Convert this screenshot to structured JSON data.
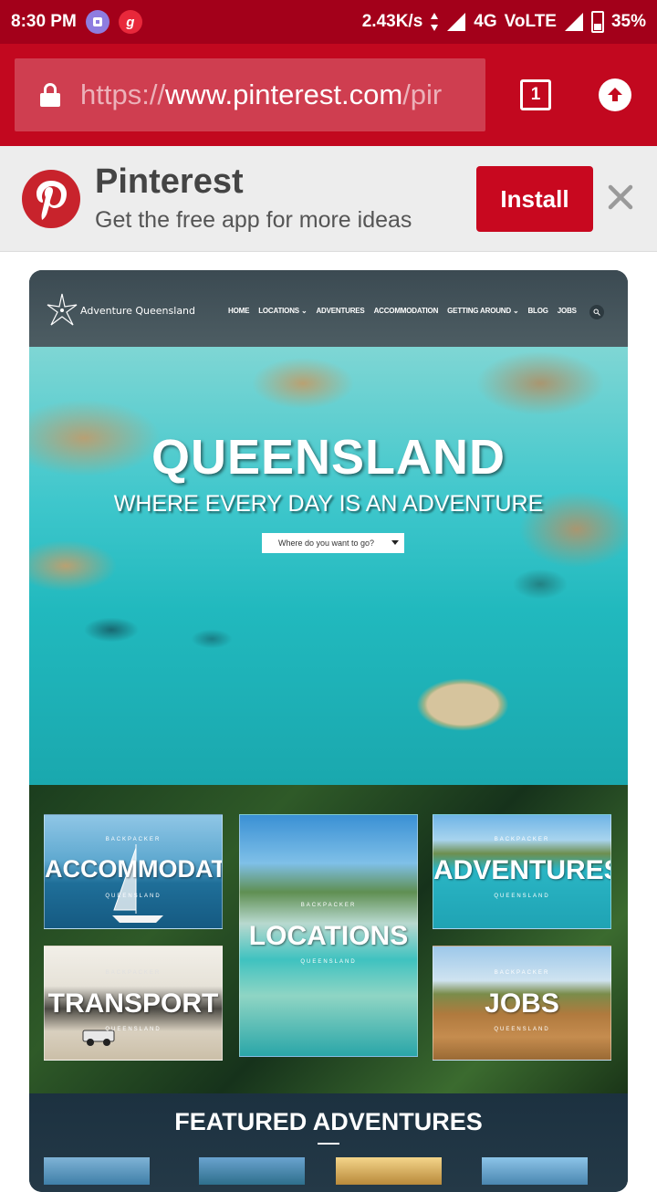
{
  "status_bar": {
    "time": "8:30 PM",
    "notif_icons": [
      "purple-app-icon",
      "red-g-app-icon"
    ],
    "notif_glyph_g": "g",
    "speed": "2.43K/s",
    "network": "4G",
    "volte": "VoLTE",
    "battery": "35%"
  },
  "browser": {
    "url_scheme": "https://",
    "url_host": "www.pinterest.com",
    "url_path": "/pir",
    "tab_count": "1"
  },
  "app_banner": {
    "title": "Pinterest",
    "subtitle": "Get the free app for more ideas",
    "install_label": "Install"
  },
  "pin": {
    "site_logo": "Adventure Queensland",
    "nav": [
      "HOME",
      "LOCATIONS ⌄",
      "ADVENTURES",
      "ACCOMMODATION",
      "GETTING AROUND ⌄",
      "BLOG",
      "JOBS"
    ],
    "hero_title": "QUEENSLAND",
    "hero_subtitle": "WHERE EVERY DAY IS AN ADVENTURE",
    "hero_select_placeholder": "Where do you want to go?",
    "tiles": {
      "accommodation": {
        "top": "BACKPACKER",
        "main": "ACCOMMODATION",
        "bottom": "QUEENSLAND"
      },
      "locations": {
        "top": "BACKPACKER",
        "main": "LOCATIONS",
        "bottom": "QUEENSLAND"
      },
      "adventures": {
        "top": "BACKPACKER",
        "main": "ADVENTURES",
        "bottom": "QUEENSLAND"
      },
      "transport": {
        "top": "BACKPACKER",
        "main": "TRANSPORT",
        "bottom": "QUEENSLAND"
      },
      "jobs": {
        "top": "BACKPACKER",
        "main": "JOBS",
        "bottom": "QUEENSLAND"
      }
    },
    "featured_title": "FEATURED ADVENTURES"
  },
  "colors": {
    "status_bar": "#a3001a",
    "toolbar": "#c2081f",
    "install_button": "#c8081f",
    "pinterest_logo": "#c8232c"
  }
}
